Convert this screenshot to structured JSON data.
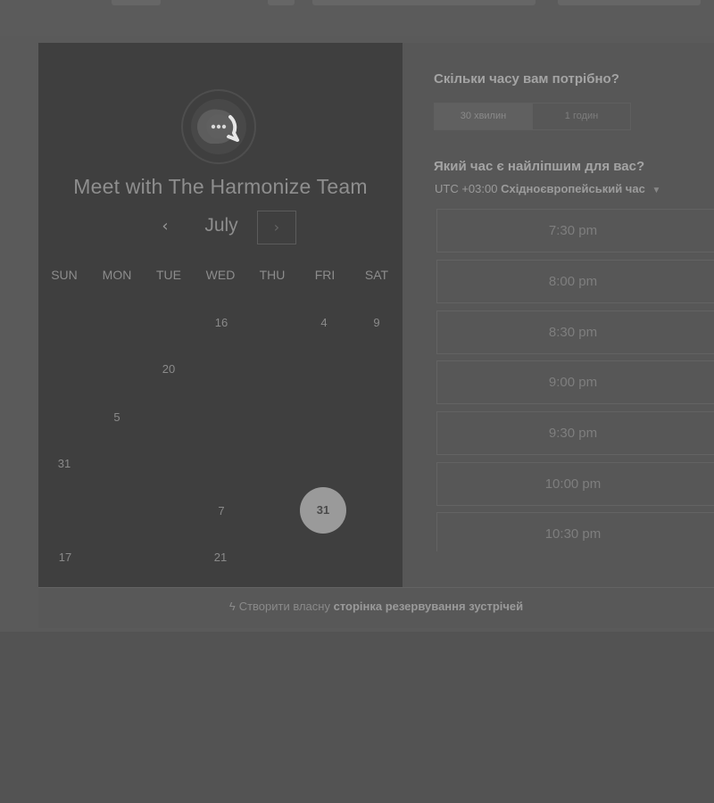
{
  "booking": {
    "title": "Meet with The Harmonize Team",
    "avatar_icon": "chat-bubble-logo-icon"
  },
  "calendar": {
    "month": "July",
    "prev_icon": "chevron-left-icon",
    "next_icon": "chevron-right-icon",
    "weekdays": [
      "SUN",
      "MON",
      "TUE",
      "WED",
      "THU",
      "FRI",
      "SAT"
    ],
    "days": [
      "16",
      "4",
      "9",
      "20",
      "5",
      "31",
      "7",
      "31",
      "17",
      "21"
    ],
    "selected_day": "31"
  },
  "duration": {
    "question": "Скільки часу вам потрібно?",
    "options": [
      "30 хвилин",
      "1 годин"
    ],
    "selected": "30 хвилин"
  },
  "time": {
    "question": "Який час є найліпшим для вас?",
    "timezone_offset": "UTC +03:00",
    "timezone_name": "Східноєвропейський час",
    "slots": [
      "7:30 pm",
      "8:00 pm",
      "8:30 pm",
      "9:00 pm",
      "9:30 pm",
      "10:00 pm",
      "10:30 pm"
    ]
  },
  "footer": {
    "prefix": "Створити власну",
    "link": "сторінка резервування зустрічей",
    "icon": "hubspot-sprocket-icon"
  },
  "colors": {
    "background": "#535353",
    "left_panel": "#3f3f3f",
    "selected_day": "#9a9a9a"
  }
}
